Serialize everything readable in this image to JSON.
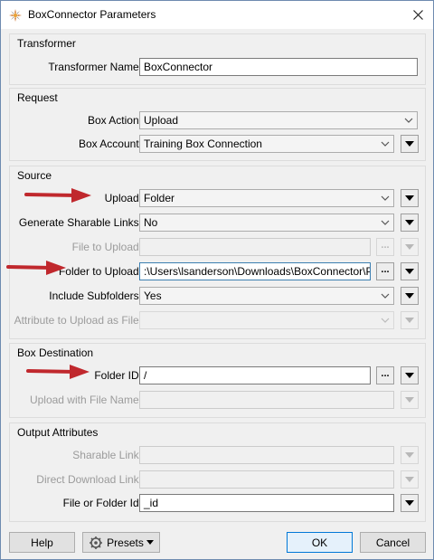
{
  "window": {
    "title": "BoxConnector Parameters"
  },
  "transformer": {
    "group_title": "Transformer",
    "name_label": "Transformer Name:",
    "name_value": "BoxConnector"
  },
  "request": {
    "group_title": "Request",
    "box_action_label": "Box Action:",
    "box_action_value": "Upload",
    "box_account_label": "Box Account:",
    "box_account_value": "Training Box Connection"
  },
  "source": {
    "group_title": "Source",
    "upload_label": "Upload:",
    "upload_value": "Folder",
    "sharable_links_label": "Generate Sharable Links:",
    "sharable_links_value": "No",
    "file_to_upload_label": "File to Upload:",
    "file_to_upload_value": "",
    "folder_to_upload_label": "Folder to Upload:",
    "folder_to_upload_value": ":\\Users\\lsanderson\\Downloads\\BoxConnector\\Parks",
    "include_subfolders_label": "Include Subfolders:",
    "include_subfolders_value": "Yes",
    "attribute_upload_label": "Attribute to Upload as File:",
    "attribute_upload_value": ""
  },
  "box_destination": {
    "group_title": "Box Destination",
    "folder_id_label": "Folder ID:",
    "folder_id_value": "/",
    "upload_with_name_label": "Upload with File Name:",
    "upload_with_name_value": ""
  },
  "output_attributes": {
    "group_title": "Output Attributes",
    "sharable_link_label": "Sharable Link:",
    "sharable_link_value": "",
    "direct_download_label": "Direct Download Link:",
    "direct_download_value": "",
    "file_folder_id_label": "File or Folder Id:",
    "file_folder_id_value": "_id"
  },
  "buttons": {
    "help": "Help",
    "presets": "Presets",
    "ok": "OK",
    "cancel": "Cancel"
  },
  "colors": {
    "annotation_arrow": "#c0282d",
    "primary_button_border": "#0078d7"
  }
}
